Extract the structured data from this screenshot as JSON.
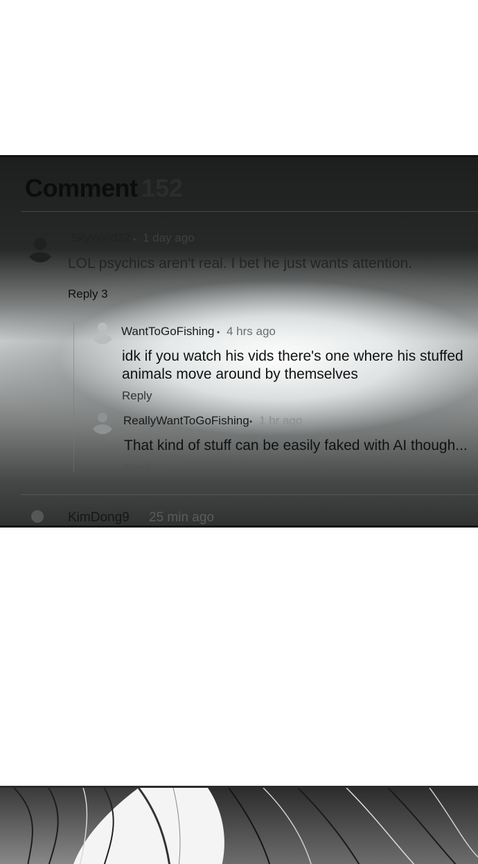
{
  "header": {
    "title": "Comment",
    "count": "152"
  },
  "comments": [
    {
      "user": "SkyWind22",
      "separator": "•",
      "time": "1 day ago",
      "text": "LOL psychics aren't real. I bet he just wants attention.",
      "reply_label": "Reply 3"
    },
    {
      "user": "WantToGoFishing",
      "separator": "•",
      "time": "4 hrs ago",
      "text_line1": "idk if you watch his vids there's one where his stuffed",
      "text_line2": "animals move around by themselves",
      "reply_label": "Reply"
    },
    {
      "user": "ReallyWantToGoFishing",
      "separator": "•",
      "time": "1 hr ago",
      "text": "That kind of stuff can be easily faked with AI though...",
      "reply_label": "Reply"
    },
    {
      "user": "KimDong9",
      "separator": "•",
      "time": "25 min ago"
    }
  ]
}
